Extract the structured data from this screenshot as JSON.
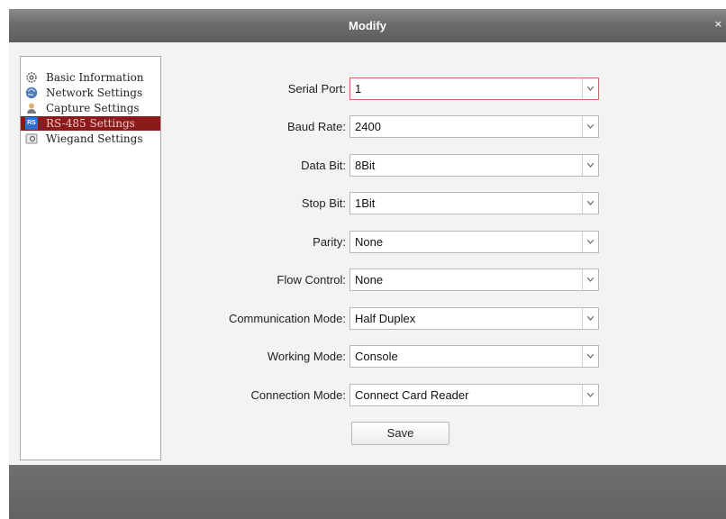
{
  "dialog": {
    "title": "Modify",
    "close_label": "×"
  },
  "sidebar": {
    "items": [
      {
        "label": "Basic Information",
        "icon": "gear-icon",
        "selected": false
      },
      {
        "label": "Network Settings",
        "icon": "globe-icon",
        "selected": false
      },
      {
        "label": "Capture Settings",
        "icon": "user-icon",
        "selected": false
      },
      {
        "label": "RS-485 Settings",
        "icon": "rs-icon",
        "icon_text": "RS",
        "selected": true
      },
      {
        "label": "Wiegand Settings",
        "icon": "card-reader-icon",
        "selected": false
      }
    ]
  },
  "form": {
    "fields": [
      {
        "label": "Serial Port:",
        "value": "1"
      },
      {
        "label": "Baud Rate:",
        "value": "2400"
      },
      {
        "label": "Data Bit:",
        "value": "8Bit"
      },
      {
        "label": "Stop Bit:",
        "value": "1Bit"
      },
      {
        "label": "Parity:",
        "value": "None"
      },
      {
        "label": "Flow Control:",
        "value": "None"
      },
      {
        "label": "Communication Mode:",
        "value": "Half Duplex"
      },
      {
        "label": "Working Mode:",
        "value": "Console"
      },
      {
        "label": "Connection Mode:",
        "value": "Connect Card Reader"
      }
    ],
    "save_label": "Save"
  },
  "colors": {
    "selected_bg": "#8b1a1a",
    "titlebar": "#6c6c6c",
    "focus_border": "#d26a6a"
  }
}
